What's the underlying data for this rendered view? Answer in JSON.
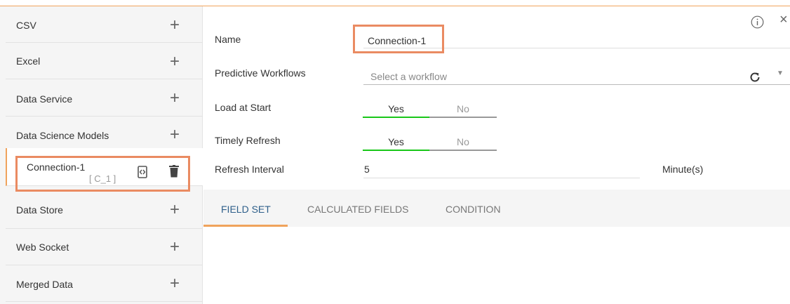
{
  "sidebar": {
    "items": [
      {
        "label": "CSV"
      },
      {
        "label": "Excel"
      },
      {
        "label": "Data Service"
      },
      {
        "label": "Data Science Models"
      },
      {
        "label": "Data Store"
      },
      {
        "label": "Web Socket"
      },
      {
        "label": "Merged Data"
      }
    ],
    "plus_symbol": "+",
    "connection": {
      "label": "Connection-1",
      "id": "[ C_1 ]"
    }
  },
  "form": {
    "name_label": "Name",
    "name_value": "Connection-1",
    "workflow_label": "Predictive Workflows",
    "workflow_placeholder": "Select a workflow",
    "load_label": "Load at Start",
    "load_yes": "Yes",
    "load_no": "No",
    "refresh_label": "Timely Refresh",
    "refresh_yes": "Yes",
    "refresh_no": "No",
    "interval_label": "Refresh Interval",
    "interval_value": "5",
    "interval_unit": "Minute(s)",
    "close_symbol": "×",
    "caret_symbol": "▼"
  },
  "tabs": [
    {
      "label": "FIELD SET"
    },
    {
      "label": "CALCULATED FIELDS"
    },
    {
      "label": "CONDITION"
    }
  ],
  "colors": {
    "accent": "#f0a35c",
    "highlight": "#ea8b62",
    "toggle_on": "#19c719",
    "tab_active": "#2e5f8a"
  }
}
